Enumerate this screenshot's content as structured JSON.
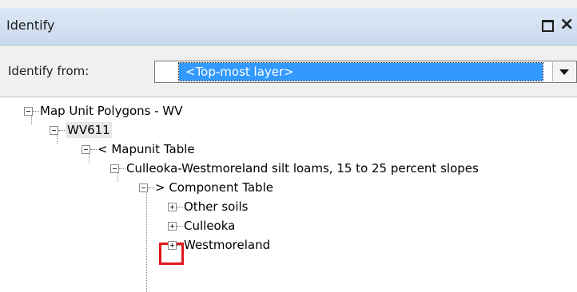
{
  "window": {
    "title": "Identify"
  },
  "toolbar": {
    "identify_from_label": "Identify from:",
    "identify_from_value": "<Top-most layer>"
  },
  "tree": {
    "nodes": [
      {
        "label": "Map Unit Polygons - WV",
        "state": "expanded"
      },
      {
        "label": "WV611",
        "state": "expanded"
      },
      {
        "label": "< Mapunit Table",
        "state": "expanded"
      },
      {
        "label": "Culleoka-Westmoreland silt loams, 15 to 25 percent slopes",
        "state": "expanded"
      },
      {
        "label": "> Component Table",
        "state": "expanded"
      },
      {
        "label": "Other soils",
        "state": "collapsed"
      },
      {
        "label": "Culleoka",
        "state": "collapsed",
        "highlighted": true
      },
      {
        "label": "Westmoreland",
        "state": "collapsed"
      }
    ]
  },
  "colors": {
    "highlight": "#e0161b",
    "selection": "#3399ff",
    "titlebar": "#c9d9ee"
  }
}
